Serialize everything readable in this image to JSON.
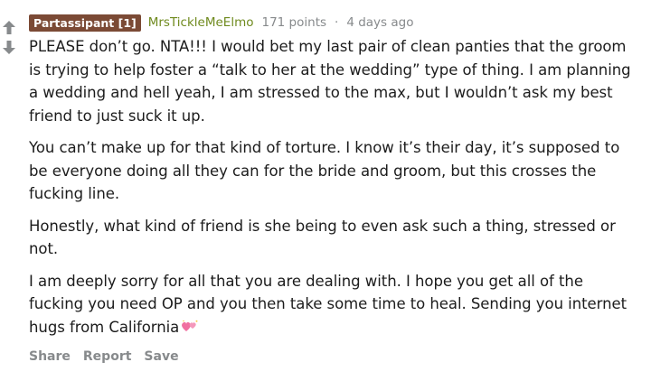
{
  "comment": {
    "flair": "Partassipant [1]",
    "author": "MrsTickleMeElmo",
    "points": "171 points",
    "separator": "·",
    "time": "4 days ago",
    "paragraphs": [
      "PLEASE don’t go. NTA!!! I would bet my last pair of clean panties that the groom is trying to help foster a “talk to her at the wedding” type of thing. I am planning a wedding and hell yeah, I am stressed to the max, but I wouldn’t ask my best friend to just suck it up.",
      "You can’t make up for that kind of torture. I know it’s their day, it’s supposed to be everyone doing all they can for the bride and groom, but this crosses the fucking line.",
      "Honestly, what kind of friend is she being to even ask such a thing, stressed or not."
    ],
    "last_paragraph": "I am deeply sorry for all that you are dealing with. I hope you get all of the fucking you need OP and you then take some time to heal. Sending you internet hugs from California",
    "emoji": "two-hearts-emoji",
    "actions": {
      "share": "Share",
      "report": "Report",
      "save": "Save"
    }
  },
  "icons": {
    "upvote": "upvote-arrow-icon",
    "downvote": "downvote-arrow-icon"
  },
  "colors": {
    "flair_bg": "#7b4a35",
    "author": "#6f8a1e",
    "muted": "#878a8c",
    "vote_arrow": "#878a8c",
    "emoji_pink": "#f06fa0"
  }
}
